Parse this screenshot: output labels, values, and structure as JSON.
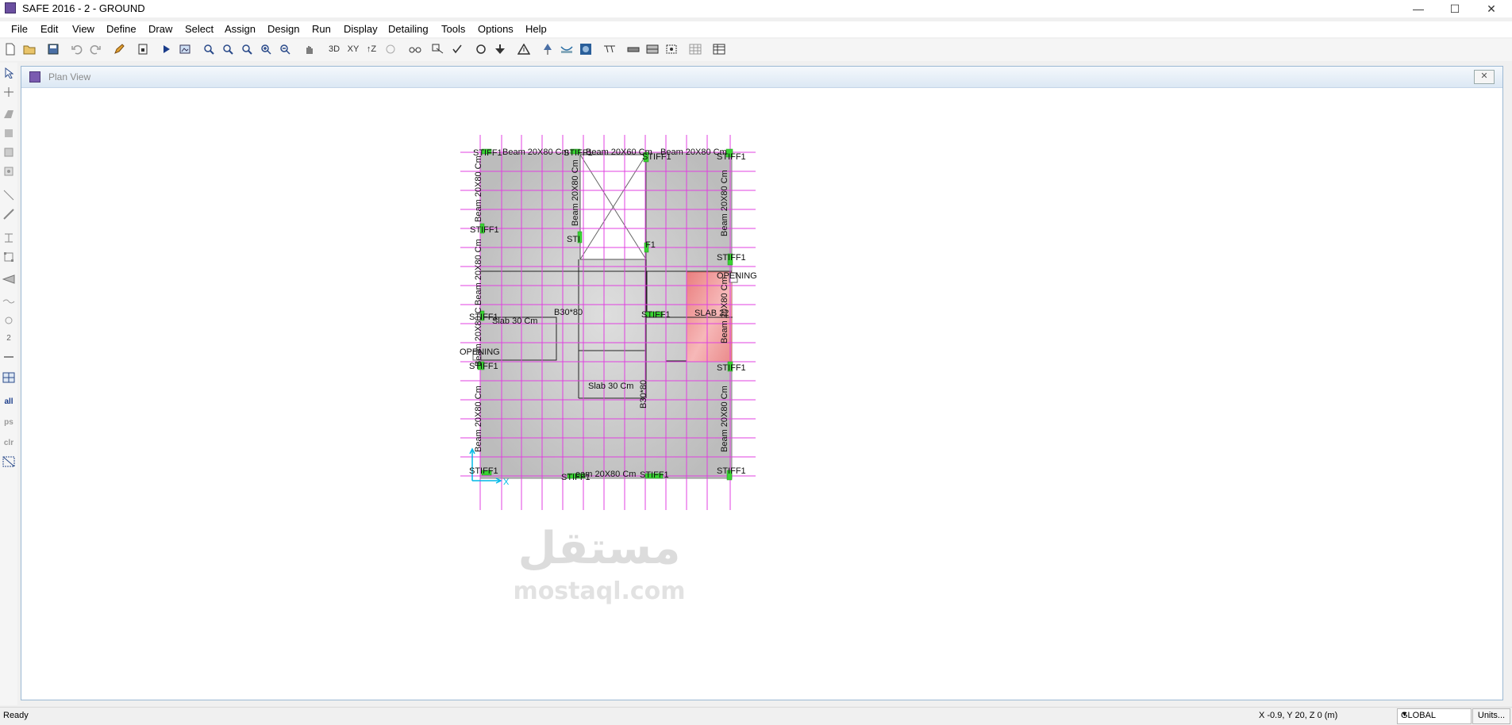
{
  "app": {
    "title": "SAFE 2016 - 2 - GROUND"
  },
  "menu": [
    "File",
    "Edit",
    "View",
    "Define",
    "Draw",
    "Select",
    "Assign",
    "Design",
    "Run",
    "Display",
    "Detailing",
    "Tools",
    "Options",
    "Help"
  ],
  "toolbar": {
    "btn_3d": "3D",
    "btn_xy": "XY",
    "btn_z": "↑Z"
  },
  "left_tools": {
    "all": "all",
    "ps": "ps",
    "clr": "clr",
    "dim": "2"
  },
  "plan": {
    "title": "Plan View",
    "labels": {
      "stiff": "STIFF1",
      "beam_2080": "Beam 20X80 Cm",
      "beam_2060": "Beam 20X60 Cm",
      "stiff_partial": "STI",
      "stiff_tail": "F1",
      "opening_right": "OPENING",
      "opening_left": "OPENING",
      "slab30_left": "Slab 30 Cm",
      "slab30_mid": "Slab 30 Cm",
      "slab22": "SLAB 22",
      "b30_80": "B30*80",
      "b30_80_vert": "B30*80",
      "beam_partial": "Beam 20X80 C",
      "beam_bottom": "eam 20X80 Cm",
      "axis_x": "X",
      "axis_y": "Y"
    },
    "watermark": {
      "arabic": "مستقل",
      "latin": "mostaql.com"
    }
  },
  "status": {
    "ready": "Ready",
    "coords": "X -0.9,  Y 20,  Z 0  (m)",
    "coord_system": "GLOBAL",
    "units_button": "Units..."
  },
  "colors": {
    "grid": "#e040e0",
    "slab": "#c4c4c4",
    "opening_fill": "#ef8c8c",
    "support": "#39d433",
    "axis": "#00b8e6"
  }
}
